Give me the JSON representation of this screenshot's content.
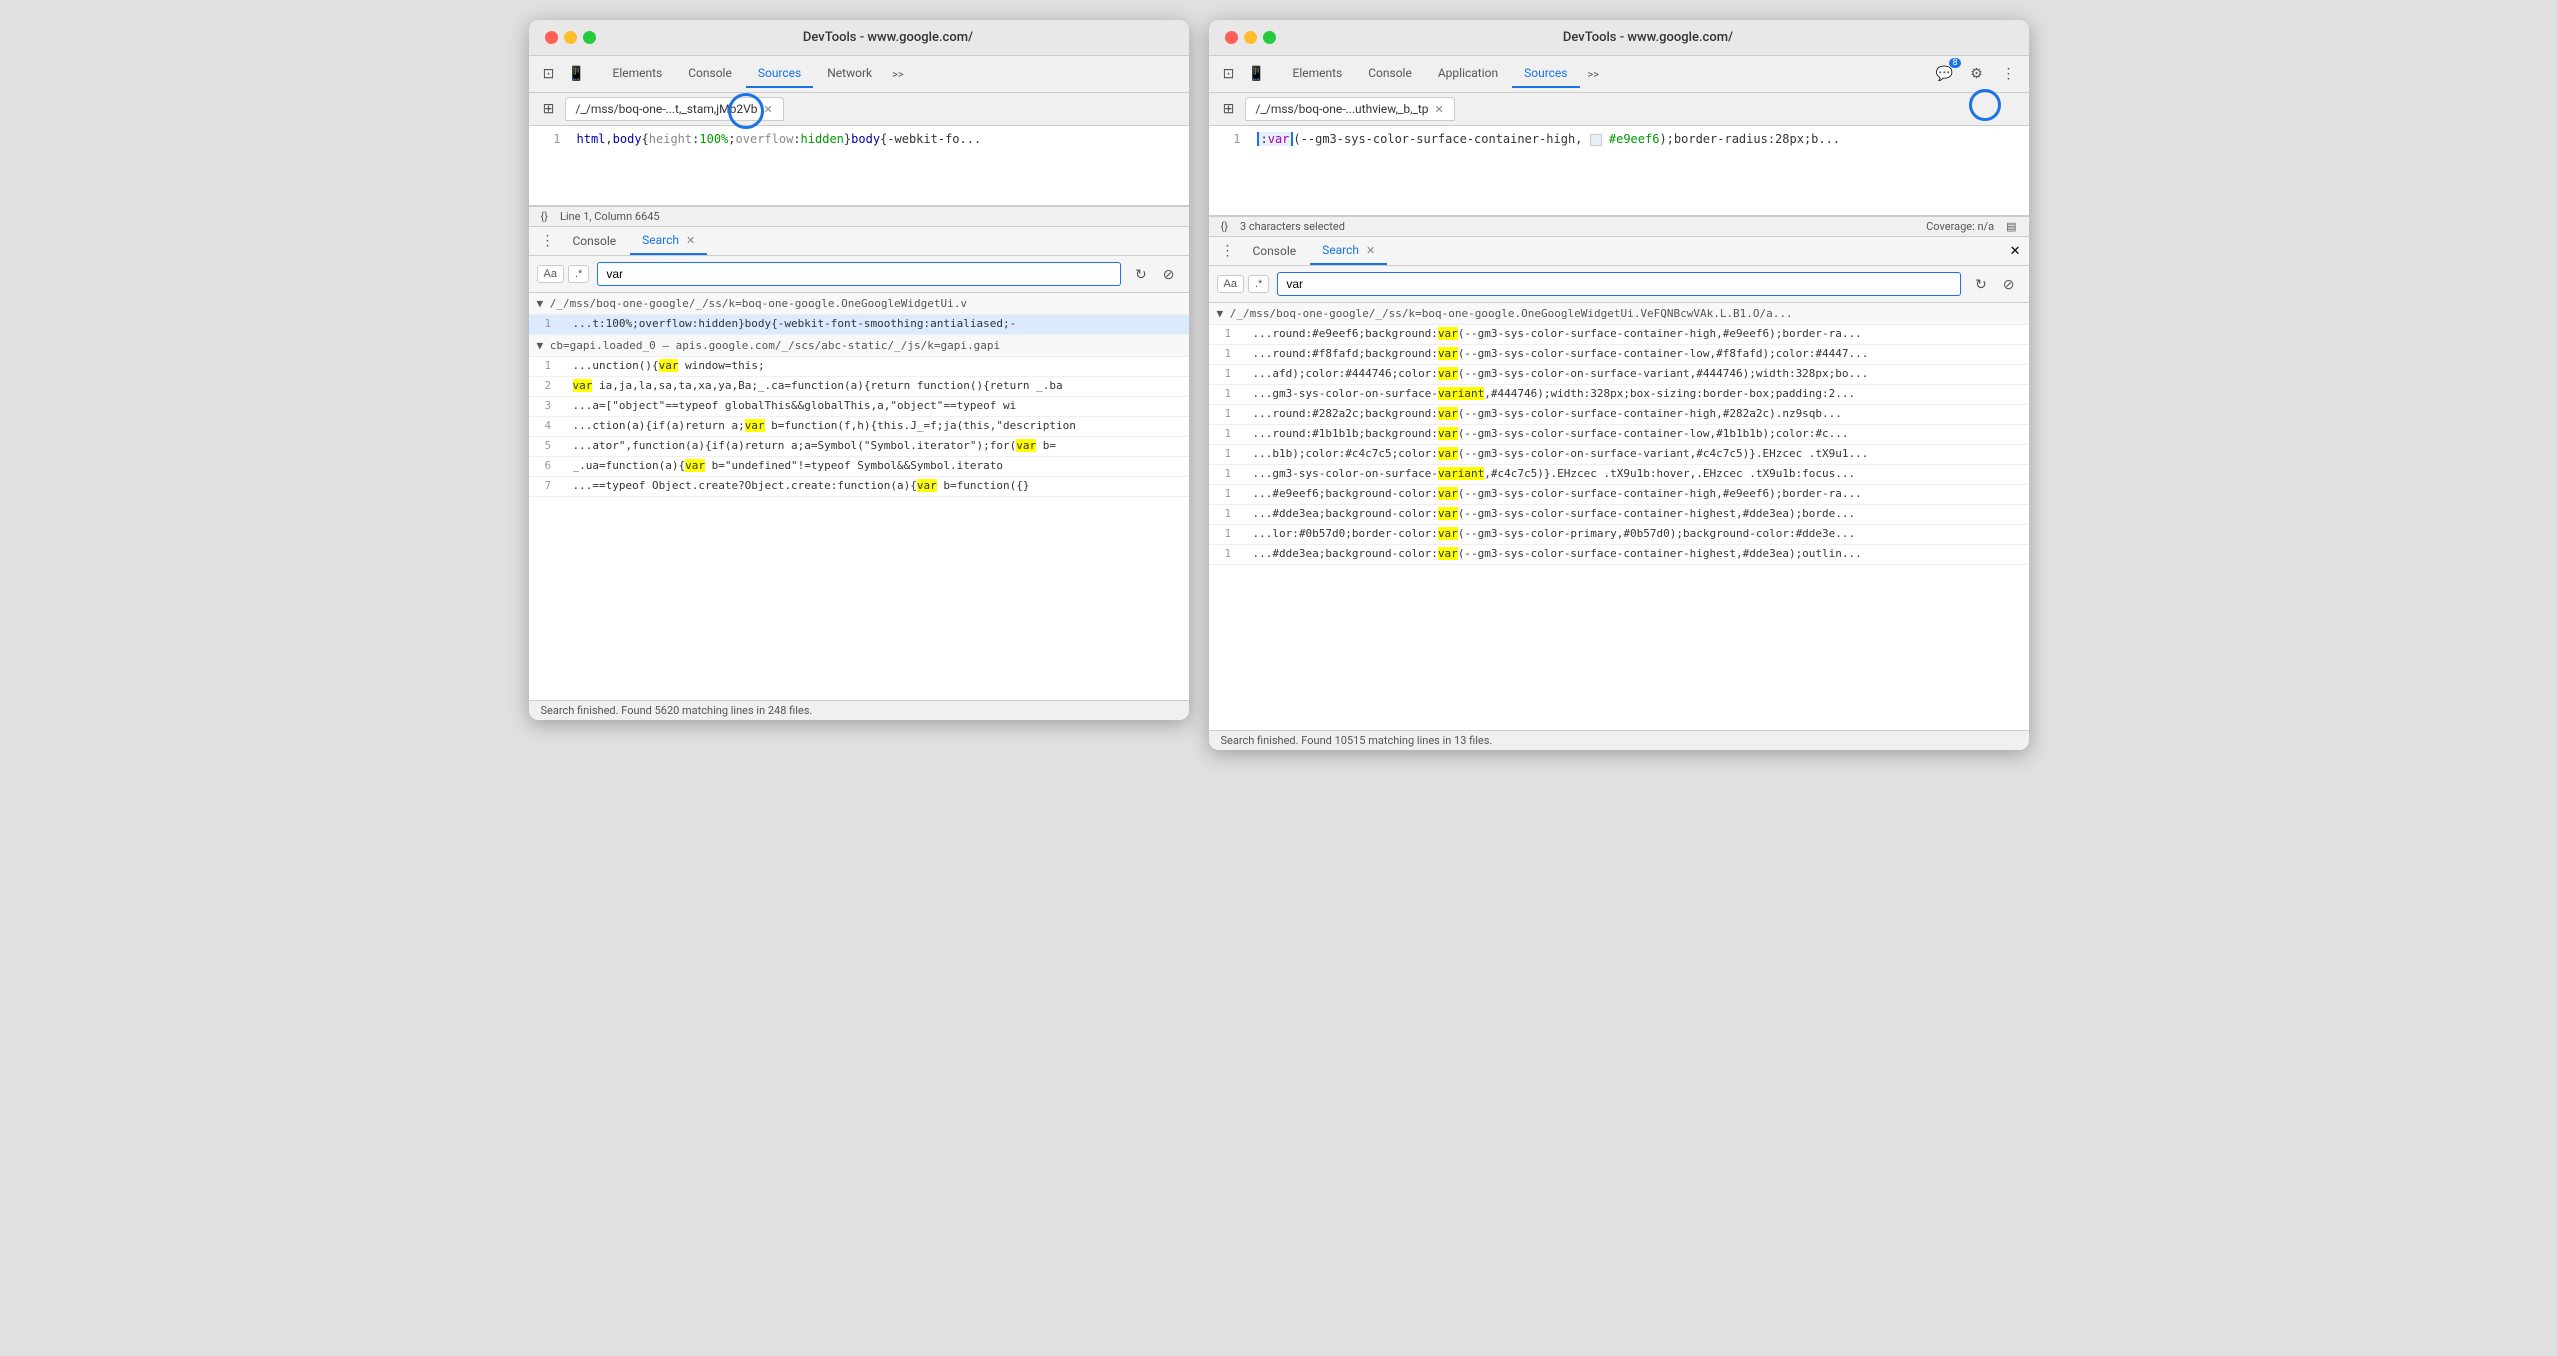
{
  "left_window": {
    "title": "DevTools - www.google.com/",
    "tabs": [
      "Elements",
      "Console",
      "Sources",
      "Network",
      ">>"
    ],
    "active_tab": "Sources",
    "file_tab": "/_/mss/boq-one-...t,_stam,jMb2Vb",
    "code_line": "html,body{height:100%;overflow:hidden}body{-webkit-fo",
    "status": "Line 1, Column 6645",
    "panel_tabs": [
      "Console",
      "Search"
    ],
    "active_panel_tab": "Search",
    "search_value": "var",
    "search_footer": "Search finished.  Found 5620 matching lines in 248 files.",
    "result_file_1": "▼ /_/mss/boq-one-google/_/ss/k=boq-one-google.OneGoogleWidgetUi.v",
    "results_1": [
      {
        "line": "1",
        "text": "...t:100%;overflow:hidden}body{-webkit-font-smoothing:antialiased;-"
      }
    ],
    "result_file_2": "▼ cb=gapi.loaded_0  —  apis.google.com/_/scs/abc-static/_/js/k=gapi.gapi",
    "results_2": [
      {
        "line": "1",
        "text": "...unction(){var window=this;"
      },
      {
        "line": "2",
        "text": "var ia,ja,la,sa,ta,xa,ya,Ba;_.ca=function(a){return function(){return _.ba"
      },
      {
        "line": "3",
        "text": "...a=[\"object\"==typeof globalThis&&globalThis,a,\"object\"==typeof wi"
      },
      {
        "line": "4",
        "text": "...ction(a){if(a)return a;var b=function(f,h){this.J_=f;ja(this,\"description"
      },
      {
        "line": "5",
        "text": "...ator\",function(a){if(a)return a;a=Symbol(\"Symbol.iterator\");for(var b="
      },
      {
        "line": "6",
        "text": "_.ua=function(a){var b=\"undefined\"!=typeof Symbol&&Symbol.iterato"
      },
      {
        "line": "7",
        "text": "...==typeof Object.create?Object.create:function(a){var b=function({}"
      }
    ]
  },
  "right_window": {
    "title": "DevTools - www.google.com/",
    "tabs": [
      "Elements",
      "Console",
      "Application",
      "Sources",
      ">>"
    ],
    "active_tab": "Sources",
    "badge_count": "8",
    "file_tab": "/_/mss/boq-one-...uthview,_b,_tp",
    "code_line_1": ":var(--gm3-sys-color-surface-container-high,",
    "code_highlight": "#e9eef6",
    "code_line_rest": ");border-radius:28px;b",
    "status_left": "3 characters selected",
    "status_right": "Coverage: n/a",
    "panel_tabs": [
      "Console",
      "Search"
    ],
    "active_panel_tab": "Search",
    "search_value": "var",
    "result_file": "▼ /_/mss/boq-one-google/_/ss/k=boq-one-google.OneGoogleWidgetUi.VeFQNBcwVAk.L.B1.O/a...",
    "results": [
      {
        "line": "1",
        "text": "...round:#e9eef6;background:var(--gm3-sys-color-surface-container-high,#e9eef6);border-ra..."
      },
      {
        "line": "1",
        "text": "...round:#f8fafd;background:var(--gm3-sys-color-surface-container-low,#f8fafd);color:#4447..."
      },
      {
        "line": "1",
        "text": "...afd);color:#444746;color:var(--gm3-sys-color-on-surface-variant,#444746);width:328px;bo..."
      },
      {
        "line": "1",
        "text": "...gm3-sys-color-on-surface-variant,#444746);width:328px;box-sizing:border-box;padding:2..."
      },
      {
        "line": "1",
        "text": "...round:#282a2c;background:var(--gm3-sys-color-surface-container-high,#282a2c).nz9sqb..."
      },
      {
        "line": "1",
        "text": "...round:#1b1b1b;background:var(--gm3-sys-color-surface-container-low,#1b1b1b);color:#c..."
      },
      {
        "line": "1",
        "text": "...b1b);color:#c4c7c5;color:var(--gm3-sys-color-on-surface-variant,#c4c7c5)}.EHzcec .tX9u1..."
      },
      {
        "line": "1",
        "text": "...gm3-sys-color-on-surface-variant,#c4c7c5)}.EHzcec .tX9u1b:hover,.EHzcec .tX9u1b:focus..."
      },
      {
        "line": "1",
        "text": "...#e9eef6;background-color:var(--gm3-sys-color-surface-container-high,#e9eef6);border-ra..."
      },
      {
        "line": "1",
        "text": "...#dde3ea;background-color:var(--gm3-sys-color-surface-container-highest,#dde3ea);borde..."
      },
      {
        "line": "1",
        "text": "...lor:#0b57d0;border-color:var(--gm3-sys-color-primary,#0b57d0);background-color:#dde3e..."
      },
      {
        "line": "1",
        "text": "...#dde3ea;background-color:var(--gm3-sys-color-surface-container-highest,#dde3ea);outlin..."
      }
    ],
    "search_footer": "Search finished.  Found 10515 matching lines in 13 files."
  }
}
